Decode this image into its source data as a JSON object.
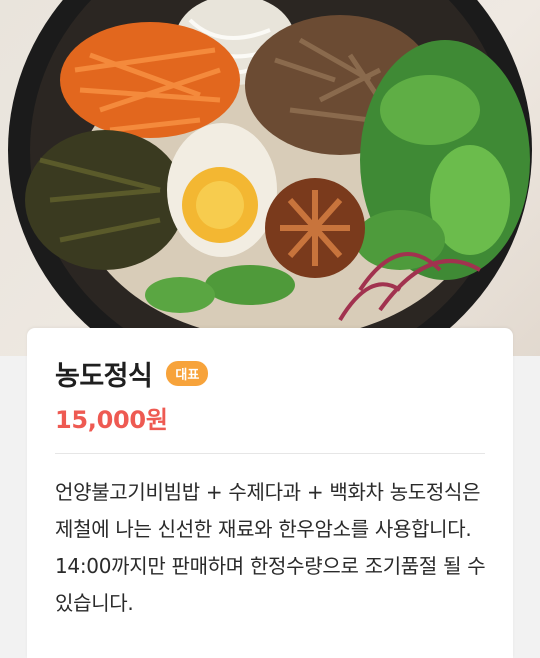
{
  "hero": {
    "image_alt": "bibimbap-bowl"
  },
  "menu": {
    "name": "농도정식",
    "badge": "대표",
    "price": "15,000원",
    "description": "언양불고기비빔밥 + 수제다과 + 백화차 농도정식은 제철에 나는 신선한 재료와 한우암소를 사용합니다. 14:00까지만 판매하며 한정수량으로 조기품절 될 수 있습니다."
  },
  "colors": {
    "price": "#ee5a52",
    "badge": "#f7a33b"
  }
}
